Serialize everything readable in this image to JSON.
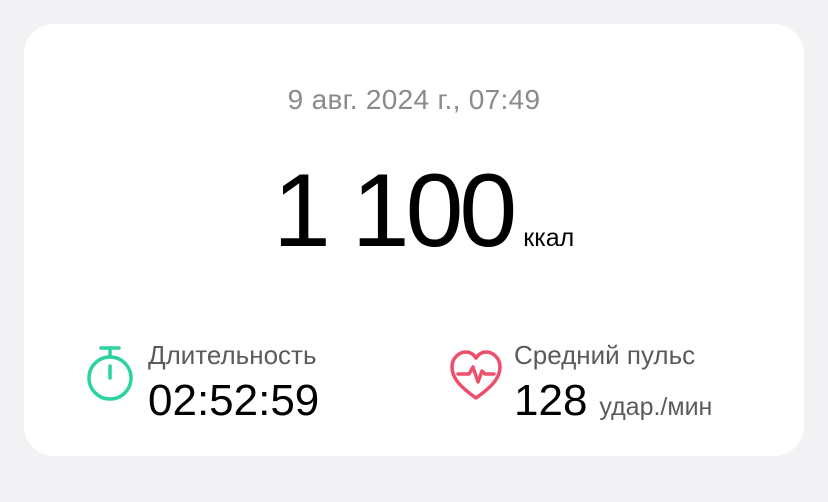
{
  "workout": {
    "date": "9 авг. 2024 г., 07:49",
    "calories_value": "1 100",
    "calories_unit": "ккал"
  },
  "metrics": {
    "duration": {
      "icon": "stopwatch-icon",
      "label": "Длительность",
      "value": "02:52:59"
    },
    "heart_rate": {
      "icon": "heart-pulse-icon",
      "label": "Средний пульс",
      "value": "128",
      "unit": "удар./мин"
    }
  },
  "colors": {
    "background": "#f2f2f4",
    "card": "#ffffff",
    "stopwatch": "#2bd3a2",
    "heart": "#ee4f6c",
    "secondary_text": "#8a8a8e"
  }
}
